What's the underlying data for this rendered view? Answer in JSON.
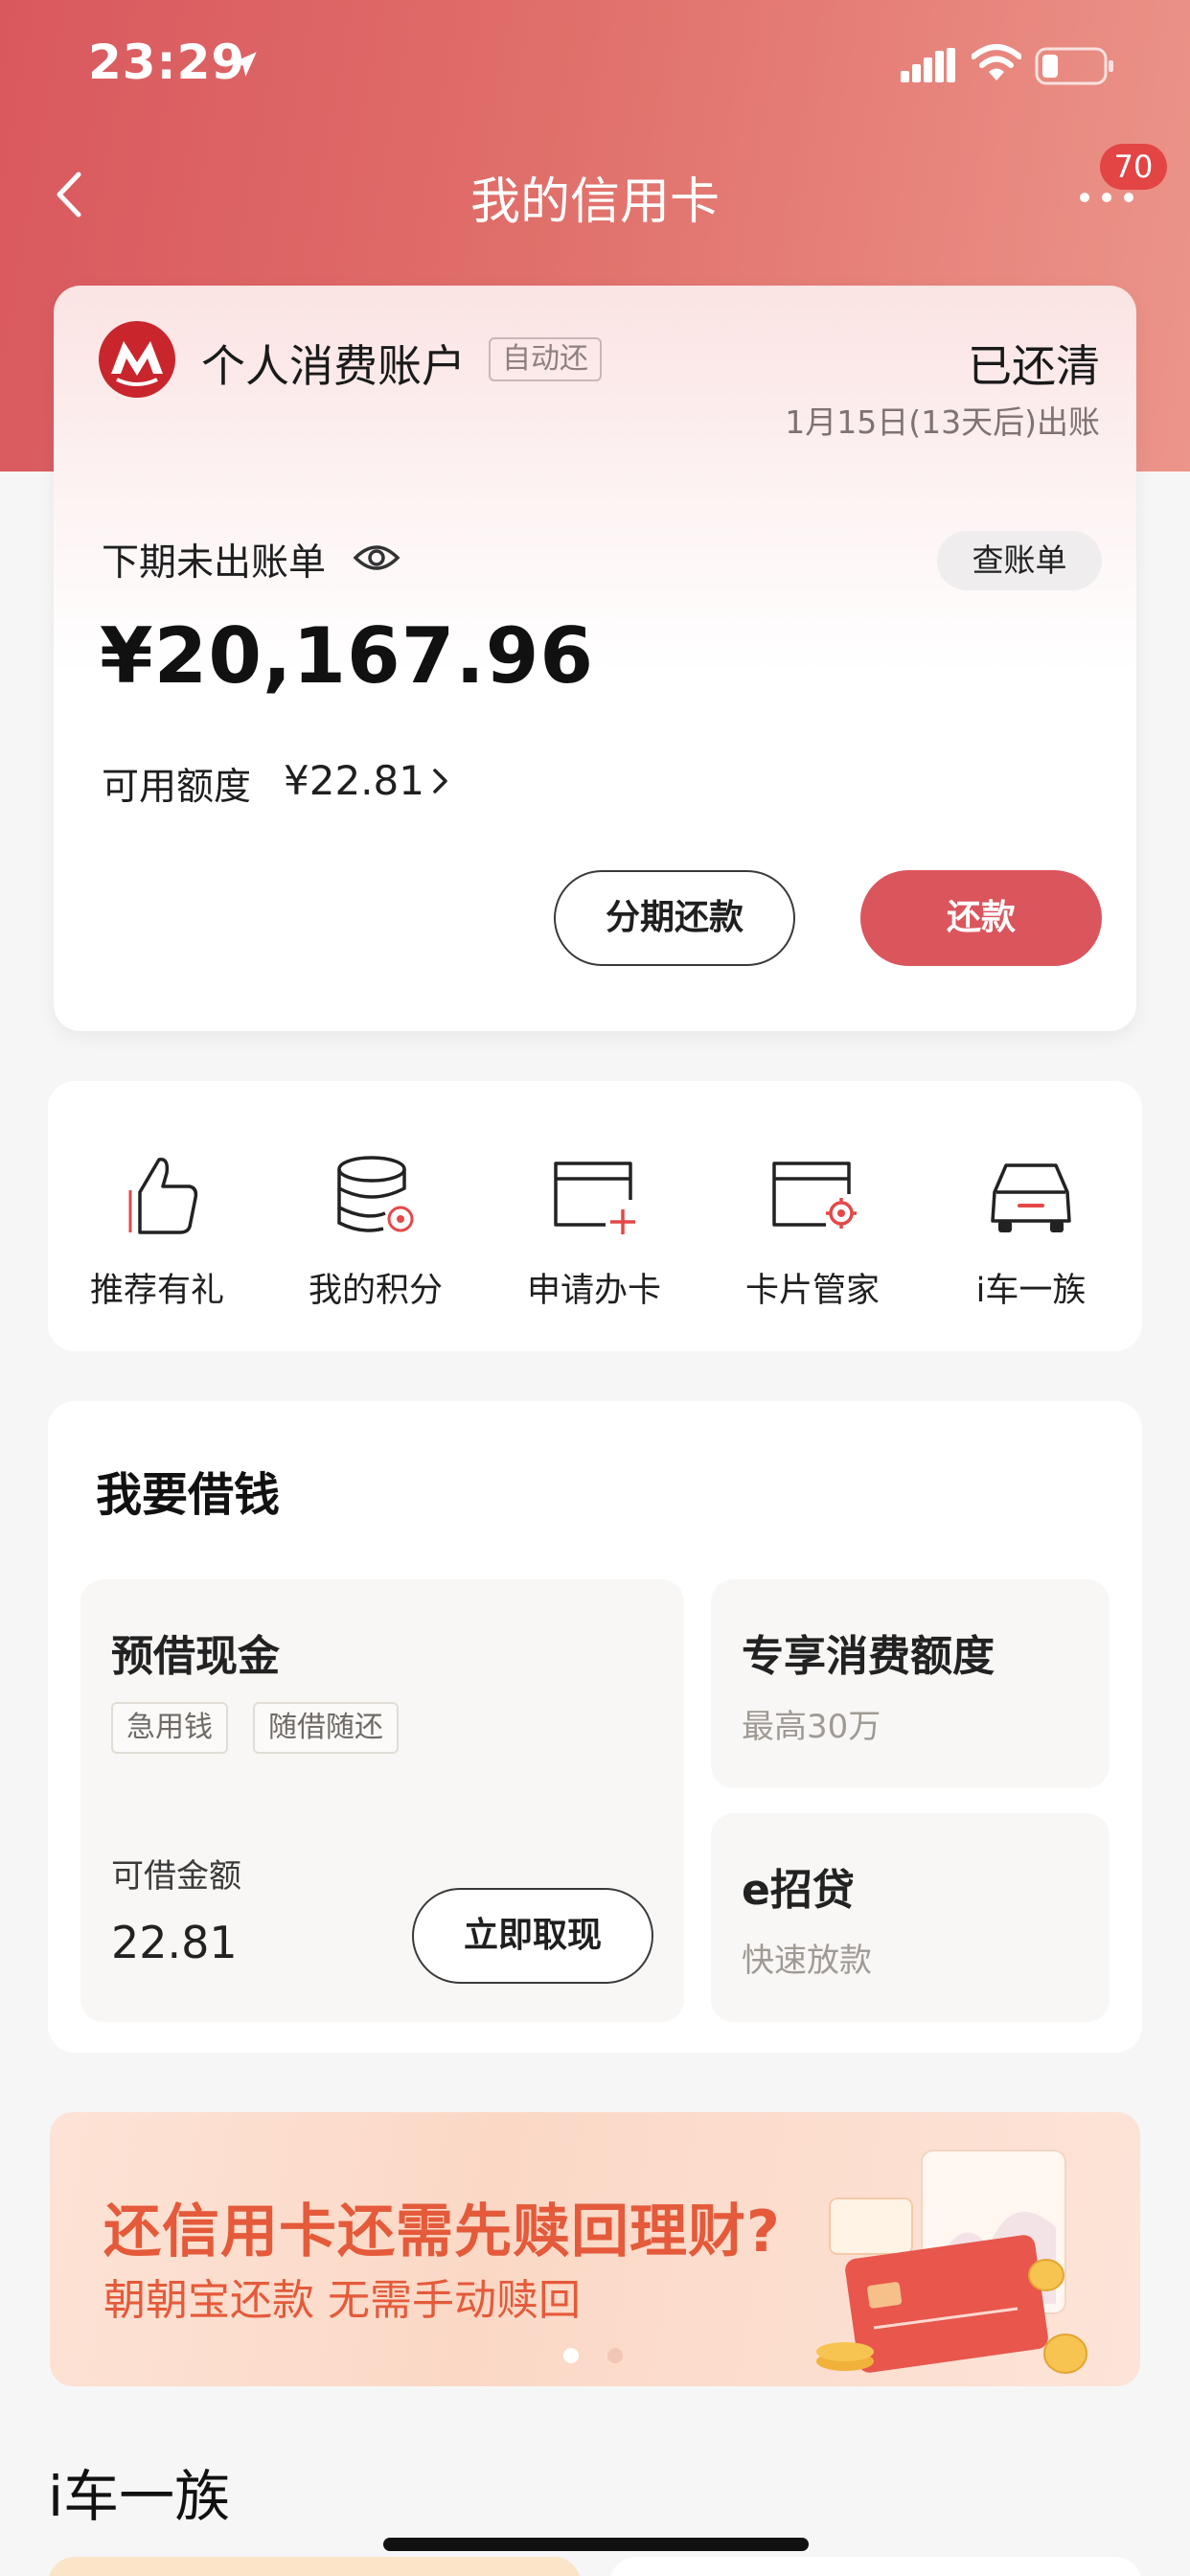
{
  "status_bar": {
    "time": "23:29"
  },
  "nav": {
    "title": "我的信用卡",
    "badge": "70"
  },
  "account": {
    "name": "个人消费账户",
    "auto_tag": "自动还",
    "status": "已还清",
    "bill_date": "1月15日(13天后)出账",
    "unbilled_label": "下期未出账单",
    "view_bill_label": "查账单",
    "amount": "¥20,167.96",
    "credit_label": "可用额度",
    "credit_value": "¥22.81",
    "installment_label": "分期还款",
    "repay_label": "还款"
  },
  "quick_entries": [
    {
      "label": "推荐有礼",
      "icon": "thumbs-up-icon"
    },
    {
      "label": "我的积分",
      "icon": "coins-stack-icon"
    },
    {
      "label": "申请办卡",
      "icon": "card-add-icon"
    },
    {
      "label": "卡片管家",
      "icon": "card-settings-icon"
    },
    {
      "label": "i车一族",
      "icon": "car-icon"
    }
  ],
  "borrow": {
    "title": "我要借钱",
    "cash": {
      "title": "预借现金",
      "tags": [
        "急用钱",
        "随借随还"
      ],
      "available_label": "可借金额",
      "available_value": "22.81",
      "button": "立即取现"
    },
    "consumption": {
      "title": "专享消费额度",
      "sub": "最高30万"
    },
    "eloan": {
      "title": "e招贷",
      "sub": "快速放款"
    }
  },
  "banner": {
    "title": "还信用卡还需先赎回理财?",
    "subtitle": "朝朝宝还款 无需手动赎回",
    "page_count": 2,
    "active_page": 1
  },
  "section": {
    "title": "i车一族"
  },
  "colors": {
    "brand_red": "#db555d",
    "banner_text": "#e45a3a"
  }
}
